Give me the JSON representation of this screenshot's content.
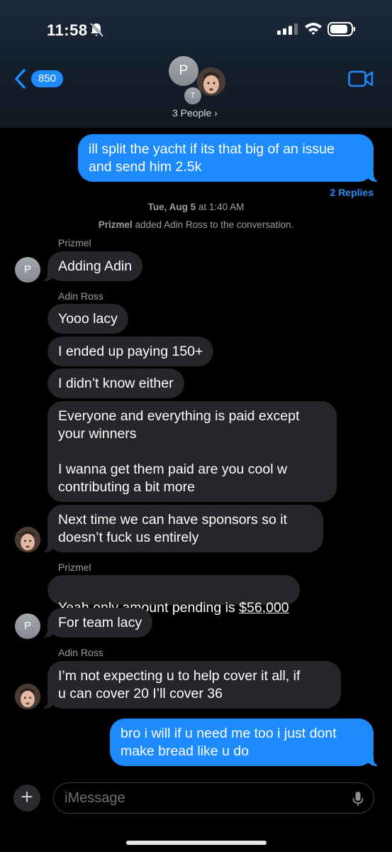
{
  "status_bar": {
    "time": "11:58"
  },
  "header": {
    "back_count": "850",
    "avatar_p": "P",
    "avatar_t": "T",
    "group_name": "3 People ›"
  },
  "thread": {
    "msg1": "ill split the yacht if its that big of an issue\nand send him 2.5k",
    "replies": "2 Replies",
    "timestamp_day": "Tue, Aug 5",
    "timestamp_at": " at ",
    "timestamp_time": "1:40 AM",
    "system_actor": "Prizmel",
    "system_text": " added Adin Ross to the conversation.",
    "sender1": "Prizmel",
    "msg2": "Adding Adin",
    "sender2": "Adin Ross",
    "msg3": "Yooo lacy",
    "msg4": "I ended up paying 150+",
    "msg5": "I didn’t know either",
    "msg6": "Everyone and everything is paid except\nyour winners\n\nI wanna get them paid are you cool w\ncontributing a bit more",
    "msg7": "Next time we can have sponsors so it\ndoesn’t fuck us entirely",
    "sender3": "Prizmel",
    "msg8_prefix": "Yeah only amount pending is ",
    "msg8_amount": "$56,000",
    "msg9": "For team lacy",
    "sender4": "Adin Ross",
    "msg10": "I’m not expecting u to help cover it all, if\nu can cover 20 I’ll cover 36",
    "msg11": "bro i will if u need me too i just dont\nmake bread like u do",
    "avatar_letter": "P"
  },
  "composer": {
    "placeholder": "iMessage",
    "plus": "+"
  },
  "colors": {
    "outgoing": "#1e8bfc",
    "incoming": "#26252a",
    "accent": "#2a8ef5"
  },
  "icons": [
    "bell-slash-icon",
    "signal-icon",
    "wifi-icon",
    "battery-icon",
    "chevron-left-icon",
    "video-icon",
    "plus-icon",
    "mic-icon"
  ]
}
